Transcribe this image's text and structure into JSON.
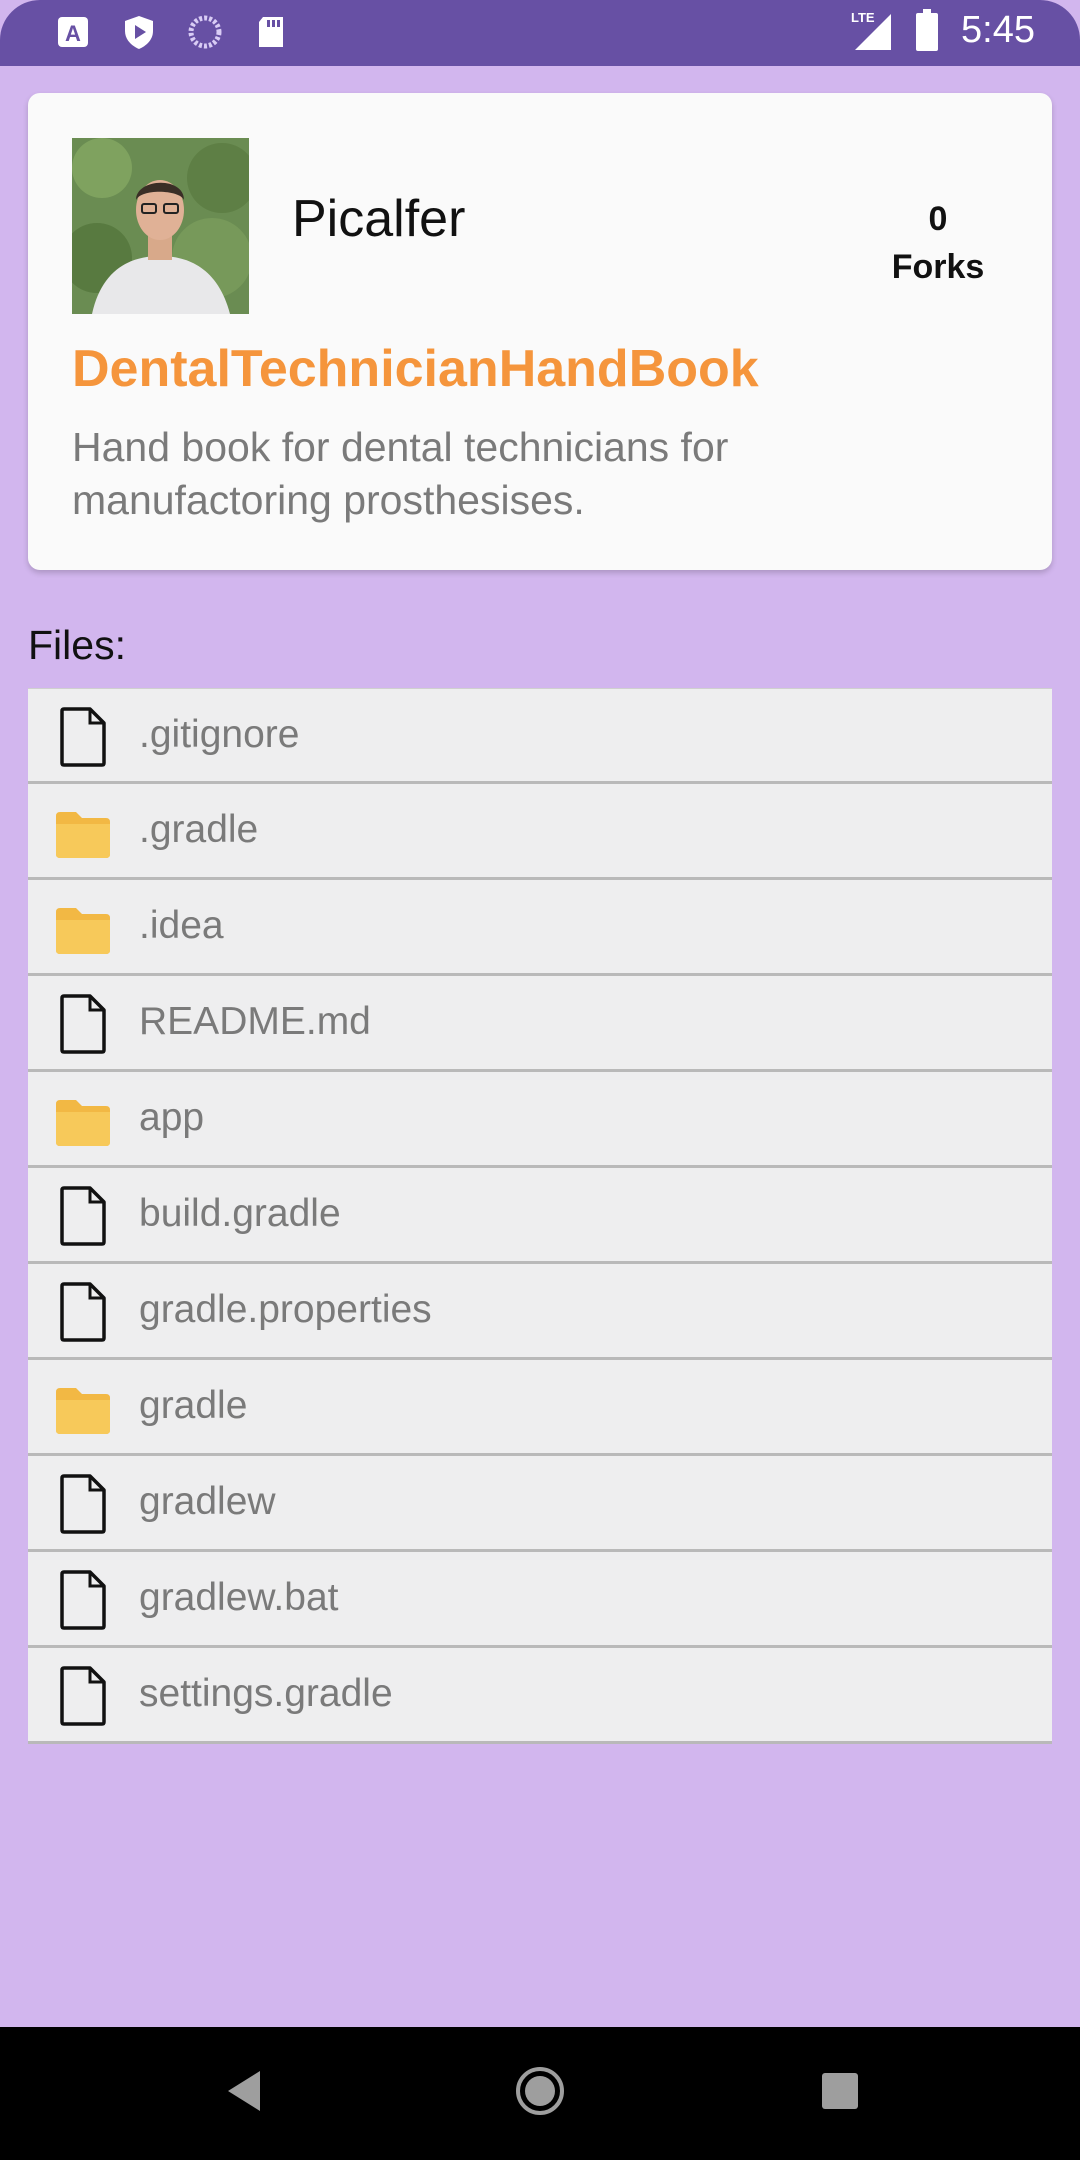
{
  "status_bar": {
    "time": "5:45",
    "network": "LTE",
    "icons": [
      "accessibility-a-icon",
      "play-protect-icon",
      "loading-circle-icon",
      "sd-card-icon",
      "lte-signal-icon",
      "battery-icon"
    ]
  },
  "repo": {
    "owner": "Picalfer",
    "forks_count": "0",
    "forks_label": "Forks",
    "name": "DentalTechnicianHandBook",
    "description": "Hand book for dental technicians for manufactoring prosthesises."
  },
  "files_label": "Files:",
  "files": [
    {
      "name": ".gitignore",
      "type": "file"
    },
    {
      "name": ".gradle",
      "type": "folder"
    },
    {
      "name": ".idea",
      "type": "folder"
    },
    {
      "name": "README.md",
      "type": "file"
    },
    {
      "name": "app",
      "type": "folder"
    },
    {
      "name": "build.gradle",
      "type": "file"
    },
    {
      "name": "gradle.properties",
      "type": "file"
    },
    {
      "name": "gradle",
      "type": "folder"
    },
    {
      "name": "gradlew",
      "type": "file"
    },
    {
      "name": "gradlew.bat",
      "type": "file"
    },
    {
      "name": "settings.gradle",
      "type": "file"
    }
  ],
  "colors": {
    "status_bar": "#6750a4",
    "background": "#d2b6ee",
    "repo_name": "#f5953c",
    "folder": "#f2b844"
  },
  "nav_bar": {
    "buttons": [
      "back-icon",
      "home-icon",
      "recents-icon"
    ]
  }
}
